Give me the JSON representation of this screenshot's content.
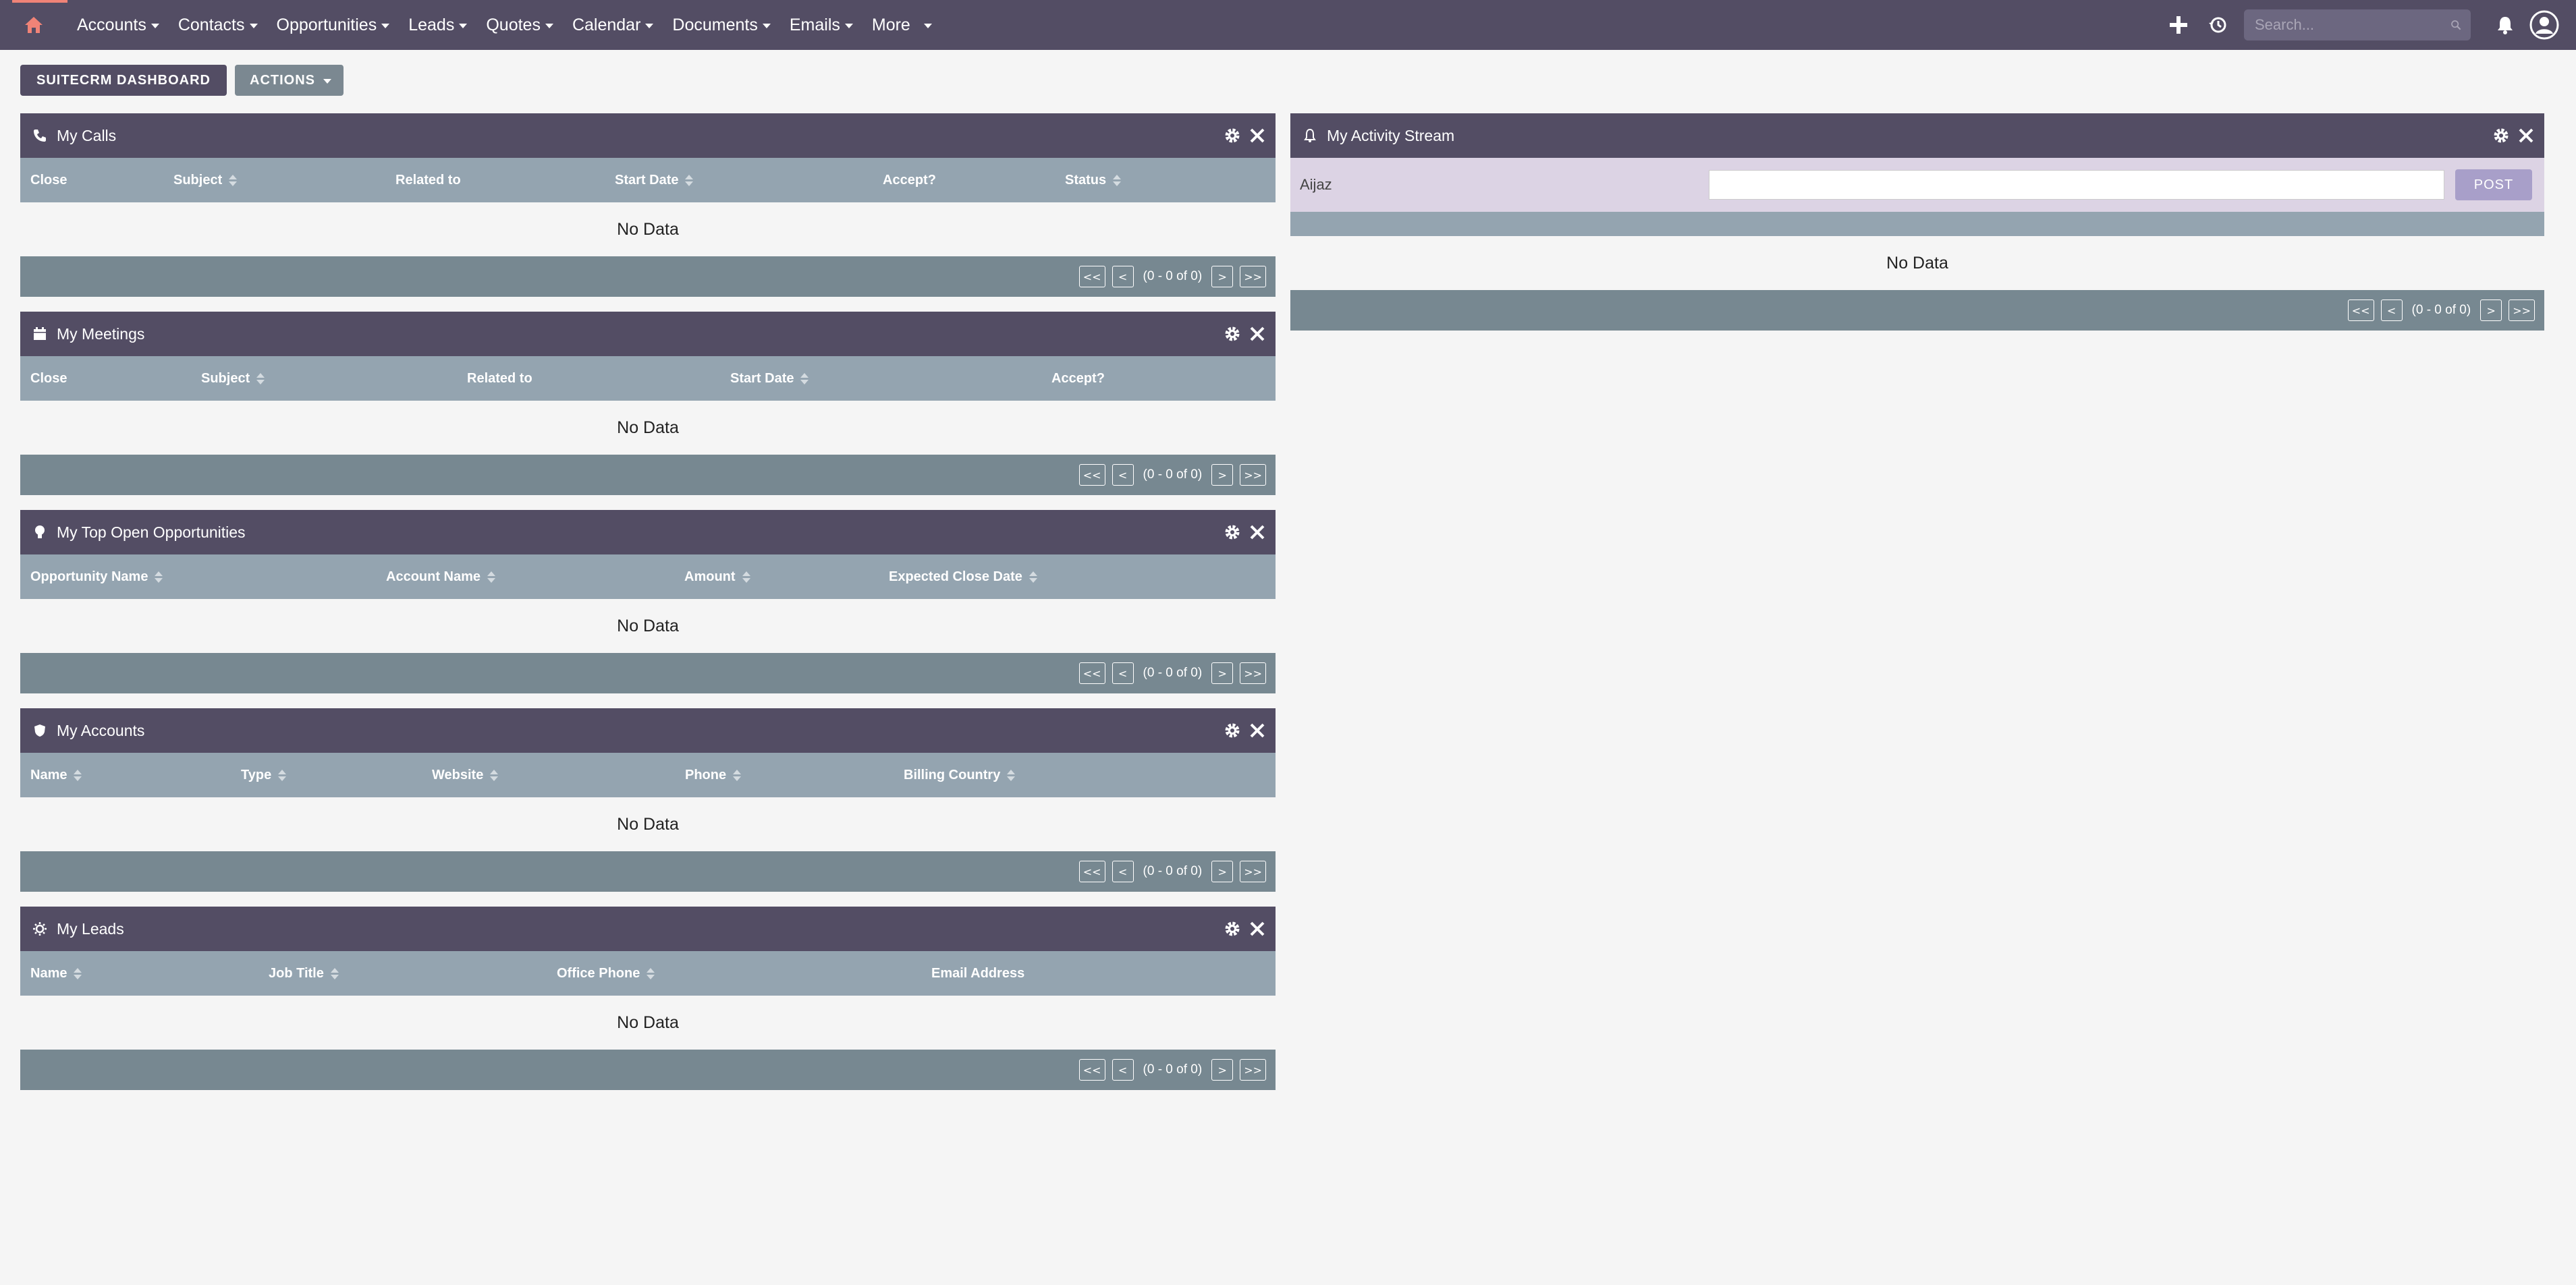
{
  "nav": {
    "items": [
      {
        "label": "Accounts"
      },
      {
        "label": "Contacts"
      },
      {
        "label": "Opportunities"
      },
      {
        "label": "Leads"
      },
      {
        "label": "Quotes"
      },
      {
        "label": "Calendar"
      },
      {
        "label": "Documents"
      },
      {
        "label": "Emails"
      },
      {
        "label": "More"
      }
    ],
    "search_placeholder": "Search..."
  },
  "dashboard": {
    "dashboard_button": "SUITECRM DASHBOARD",
    "actions_button": "ACTIONS"
  },
  "dashlets": {
    "calls": {
      "title": "My Calls",
      "columns": [
        "Close",
        "Subject",
        "Related to",
        "Start Date",
        "Accept?",
        "Status"
      ],
      "empty": "No Data",
      "pagination": "(0 - 0 of 0)"
    },
    "meetings": {
      "title": "My Meetings",
      "columns": [
        "Close",
        "Subject",
        "Related to",
        "Start Date",
        "Accept?"
      ],
      "empty": "No Data",
      "pagination": "(0 - 0 of 0)"
    },
    "opportunities": {
      "title": "My Top Open Opportunities",
      "columns": [
        "Opportunity Name",
        "Account Name",
        "Amount",
        "Expected Close Date"
      ],
      "empty": "No Data",
      "pagination": "(0 - 0 of 0)"
    },
    "accounts": {
      "title": "My Accounts",
      "columns": [
        "Name",
        "Type",
        "Website",
        "Phone",
        "Billing Country"
      ],
      "empty": "No Data",
      "pagination": "(0 - 0 of 0)"
    },
    "leads": {
      "title": "My Leads",
      "columns": [
        "Name",
        "Job Title",
        "Office Phone",
        "Email Address"
      ],
      "empty": "No Data",
      "pagination": "(0 - 0 of 0)"
    },
    "activity": {
      "title": "My Activity Stream",
      "user": "Aijaz",
      "post_label": "POST",
      "empty": "No Data",
      "pagination": "(0 - 0 of 0)"
    }
  },
  "pager": {
    "first": "<<",
    "prev": "<",
    "next": ">",
    "last": ">>"
  },
  "colors": {
    "nav": "#534d64",
    "header_row": "#94a4b0",
    "footer": "#778891",
    "accent": "#f08377"
  }
}
